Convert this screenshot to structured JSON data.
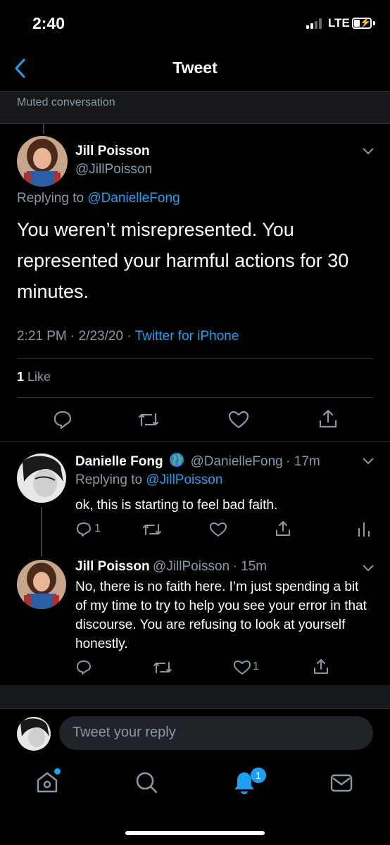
{
  "status_bar": {
    "time": "2:40",
    "network": "LTE"
  },
  "header": {
    "title": "Tweet"
  },
  "muted": {
    "label": "Muted conversation"
  },
  "main_tweet": {
    "name": "Jill Poisson",
    "handle": "@JillPoisson",
    "replying_prefix": "Replying to",
    "replying_to": "@DanielleFong",
    "text": "You weren’t misrepresented. You represented your harmful actions for 30 minutes.",
    "timestamp": "2:21 PM · 2/23/20 · ",
    "source": "Twitter for iPhone",
    "like_count": "1",
    "like_label": "Like"
  },
  "replies": [
    {
      "name": "Danielle Fong",
      "handle": "@DanielleFong",
      "time": "· 17m",
      "replying_prefix": "Replying to",
      "replying_to": "@JillPoisson",
      "text": "ok, this is starting to feel bad faith.",
      "reply_count": "1",
      "like_count": ""
    },
    {
      "name": "Jill Poisson",
      "handle": "@JillPoisson",
      "time": "· 15m",
      "text": "No, there is no faith here. I’m just spending a bit of my time to try to help you see your error in that discourse. You are refusing to look at yourself honestly.",
      "reply_count": "",
      "like_count": "1"
    }
  ],
  "composer": {
    "placeholder": "Tweet your reply"
  },
  "tabbar": {
    "notifications_badge": "1"
  },
  "colors": {
    "accent": "#1da1f2",
    "muted": "#8899a6",
    "bg": "#000000"
  },
  "icons": [
    "back-chevron-icon",
    "reply-icon",
    "retweet-icon",
    "like-icon",
    "share-icon",
    "analytics-icon",
    "home-icon",
    "search-icon",
    "notifications-icon",
    "messages-icon",
    "globe-icon"
  ]
}
